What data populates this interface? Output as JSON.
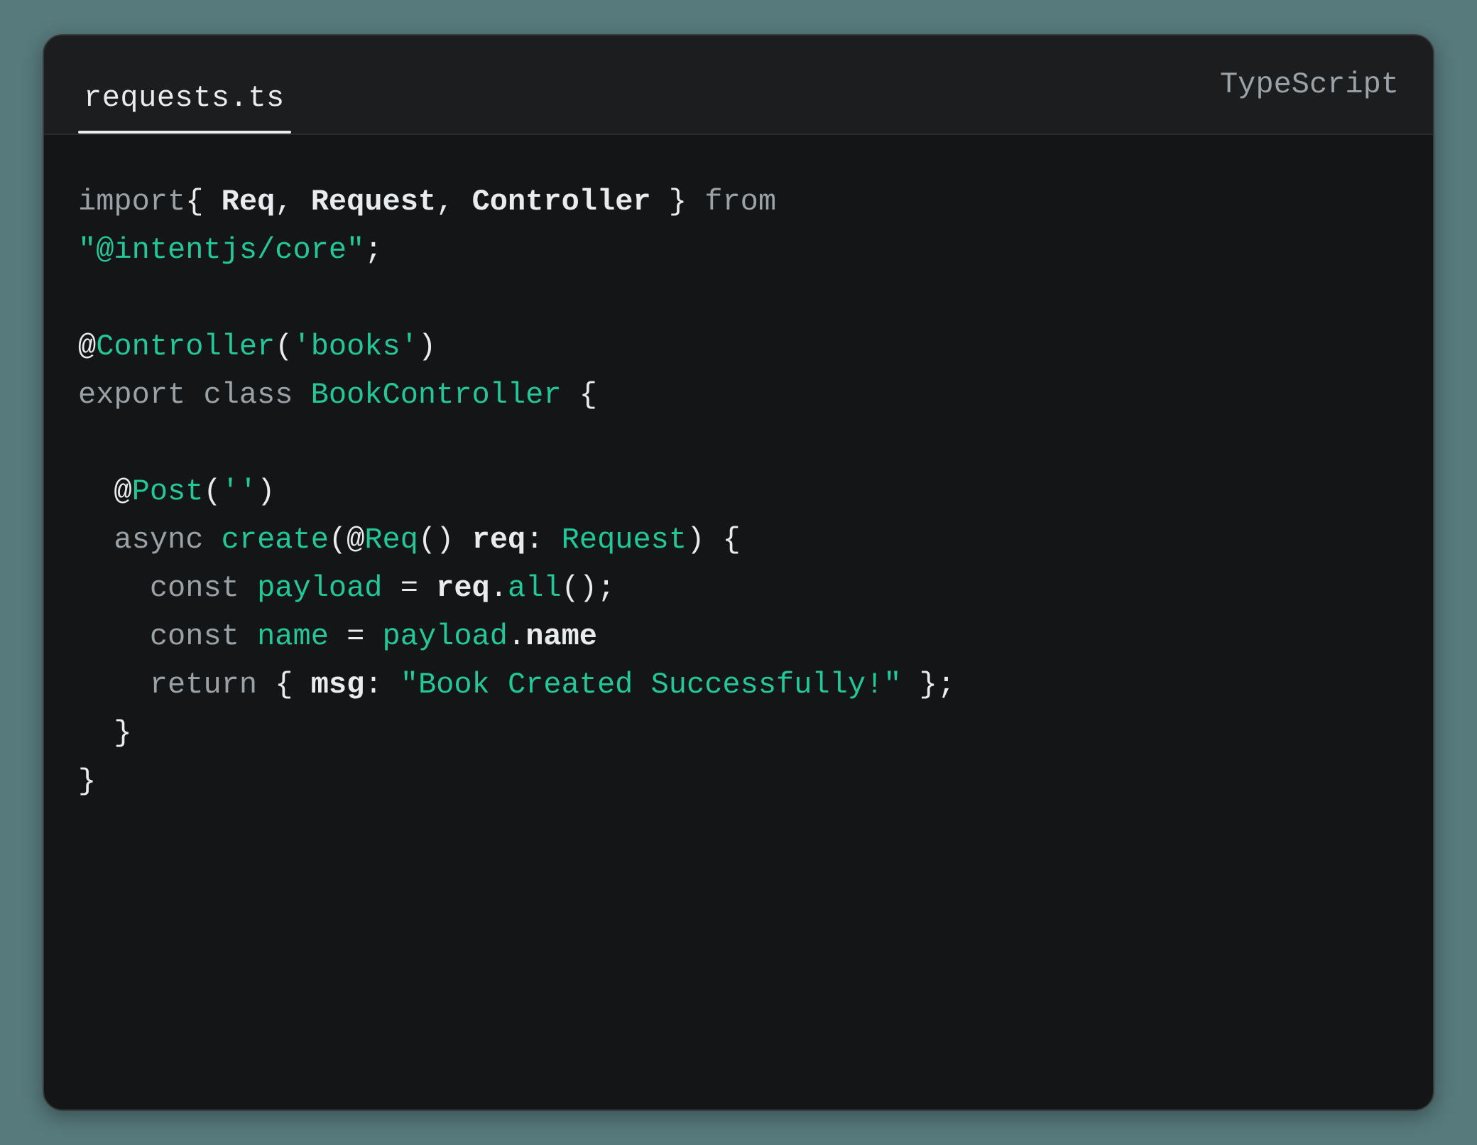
{
  "header": {
    "filename": "requests.ts",
    "language": "TypeScript"
  },
  "code": {
    "l1": {
      "t1": "import",
      "t2": "{ ",
      "t3": "Req",
      "t4": ", ",
      "t5": "Request",
      "t6": ", ",
      "t7": "Controller",
      "t8": " }",
      "t9": " from"
    },
    "l2": {
      "t1": "\"@intentjs/core\"",
      "t2": ";"
    },
    "l3": {
      "t1": ""
    },
    "l4": {
      "t1": "@",
      "t2": "Controller",
      "t3": "(",
      "t4": "'books'",
      "t5": ")"
    },
    "l5": {
      "t1": "export",
      "t2": " class ",
      "t3": "BookController",
      "t4": " {"
    },
    "l6": {
      "t1": ""
    },
    "l7": {
      "t1": "  ",
      "t2": "@",
      "t3": "Post",
      "t4": "(",
      "t5": "''",
      "t6": ")"
    },
    "l8": {
      "t1": "  ",
      "t2": "async",
      "t3": " ",
      "t4": "create",
      "t5": "(",
      "t6": "@",
      "t7": "Req",
      "t8": "()",
      "t9": " ",
      "t10": "req",
      "t11": ": ",
      "t12": "Request",
      "t13": ") {"
    },
    "l9": {
      "t1": "    ",
      "t2": "const",
      "t3": " ",
      "t4": "payload",
      "t5": " = ",
      "t6": "req",
      "t7": ".",
      "t8": "all",
      "t9": "();"
    },
    "l10": {
      "t1": "    ",
      "t2": "const",
      "t3": " ",
      "t4": "name",
      "t5": " = ",
      "t6": "payload",
      "t7": ".",
      "t8": "name"
    },
    "l11": {
      "t1": "    ",
      "t2": "return",
      "t3": " { ",
      "t4": "msg",
      "t5": ": ",
      "t6": "\"Book Created Successfully!\"",
      "t7": " };"
    },
    "l12": {
      "t1": "  }"
    },
    "l13": {
      "t1": "}"
    }
  }
}
